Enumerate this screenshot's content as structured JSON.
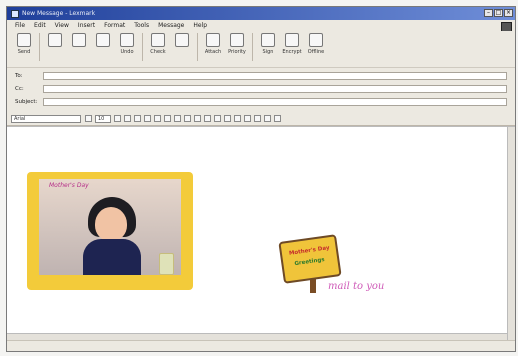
{
  "window": {
    "title": "New Message - Lexmark"
  },
  "menubar": {
    "items": [
      "File",
      "Edit",
      "View",
      "Insert",
      "Format",
      "Tools",
      "Message",
      "Help"
    ]
  },
  "toolbar": {
    "buttons": [
      {
        "label": "Send",
        "icon": "send-icon"
      },
      {
        "label": "",
        "icon": "cut-icon"
      },
      {
        "label": "",
        "icon": "copy-icon"
      },
      {
        "label": "",
        "icon": "paste-icon"
      },
      {
        "label": "Undo",
        "icon": "undo-icon"
      },
      {
        "label": "Check",
        "icon": "check-icon"
      },
      {
        "label": "",
        "icon": "spelling-icon"
      },
      {
        "label": "Attach",
        "icon": "attach-icon"
      },
      {
        "label": "Priority",
        "icon": "priority-icon"
      },
      {
        "label": "Sign",
        "icon": "sign-icon"
      },
      {
        "label": "Encrypt",
        "icon": "encrypt-icon"
      },
      {
        "label": "Offline",
        "icon": "offline-icon"
      }
    ]
  },
  "headers": {
    "to_label": "To:",
    "cc_label": "Cc:",
    "subject_label": "Subject:"
  },
  "format": {
    "font_value": "Arial",
    "size_value": "10"
  },
  "content": {
    "photo_caption": "Mother's Day",
    "sign_line1": "Mother's Day",
    "sign_line2": "Greetings",
    "message": "mail to you"
  }
}
